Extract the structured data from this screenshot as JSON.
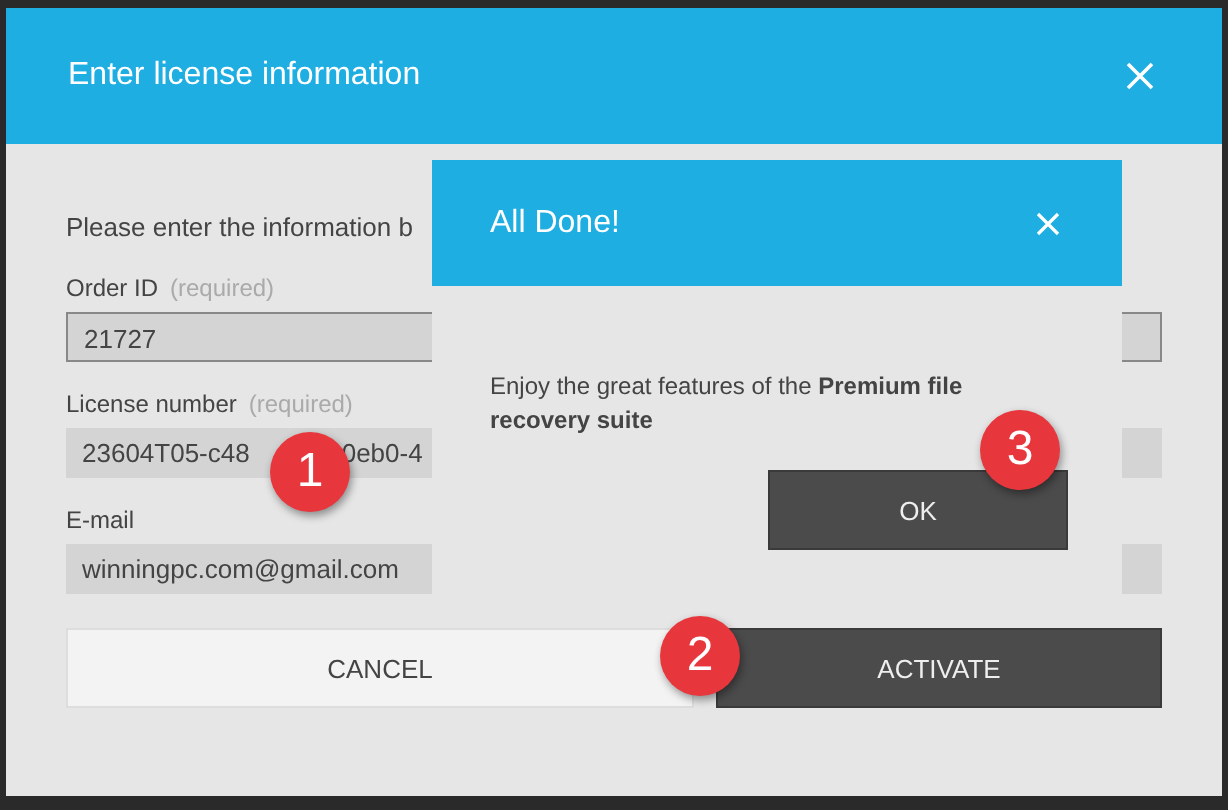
{
  "dialog": {
    "title": "Enter license information",
    "intro": "Please enter the information b",
    "fields": [
      {
        "label": "Order ID",
        "hint": "(required)",
        "value_parts": [
          "21727"
        ],
        "kind": "bordered"
      },
      {
        "label": "License number",
        "hint": "(required)",
        "value_parts": [
          "23604T05-c48",
          "0eb0-4"
        ],
        "kind": "plain"
      },
      {
        "label": "E-mail",
        "value_parts": [
          "winningpc.com@gmail.com"
        ],
        "kind": "plain"
      }
    ],
    "buttons": [
      {
        "label": "CANCEL",
        "kind": "secondary"
      },
      {
        "label": "ACTIVATE",
        "kind": "primary"
      }
    ]
  },
  "popup": {
    "title": "All Done!",
    "message": "Enjoy the great features of the **Premium file recovery suite**",
    "button": "OK"
  },
  "step_badges": [
    "1",
    "2",
    "3"
  ]
}
